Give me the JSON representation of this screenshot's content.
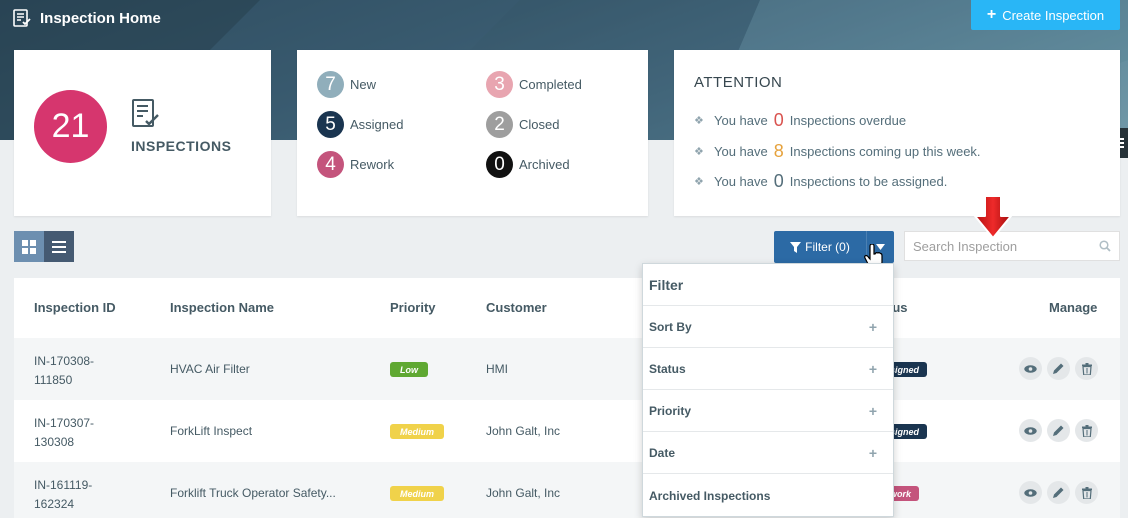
{
  "header": {
    "title": "Inspection Home",
    "create_button": "Create Inspection"
  },
  "summary": {
    "total": "21",
    "total_label": "INSPECTIONS"
  },
  "stats": [
    {
      "count": "7",
      "label": "New",
      "color": "#90aebb"
    },
    {
      "count": "5",
      "label": "Assigned",
      "color": "#1a3550"
    },
    {
      "count": "4",
      "label": "Rework",
      "color": "#c4547c"
    },
    {
      "count": "3",
      "label": "Completed",
      "color": "#e8a5b0"
    },
    {
      "count": "2",
      "label": "Closed",
      "color": "#9e9e9e"
    },
    {
      "count": "0",
      "label": "Archived",
      "color": "#111111"
    }
  ],
  "attention": {
    "title": "ATTENTION",
    "items": [
      {
        "prefix": "You have",
        "num": "0",
        "suffix": "Inspections overdue",
        "color": "#d9534f"
      },
      {
        "prefix": "You have",
        "num": "8",
        "suffix": "Inspections coming up this week.",
        "color": "#e6a23c"
      },
      {
        "prefix": "You have",
        "num": "0",
        "suffix": "Inspections to be assigned.",
        "color": "#546e7a"
      }
    ]
  },
  "toolbar": {
    "filter_label": "Filter (0)",
    "search_placeholder": "Search Inspection"
  },
  "table": {
    "headers": [
      "Inspection ID",
      "Inspection Name",
      "Priority",
      "Customer",
      "tus",
      "Manage"
    ],
    "rows": [
      {
        "id_line1": "IN-170308-",
        "id_line2": "111850",
        "name": "HVAC Air Filter",
        "priority": "Low",
        "priority_color": "#5fa832",
        "priority_text": "#ffffff",
        "customer": "HMI",
        "status": "signed",
        "status_color": "#1a3550"
      },
      {
        "id_line1": "IN-170307-",
        "id_line2": "130308",
        "name": "ForkLift Inspect",
        "priority": "Medium",
        "priority_color": "#f0d24a",
        "priority_text": "#ffffff",
        "customer": "John Galt, Inc",
        "status": "signed",
        "status_color": "#1a3550"
      },
      {
        "id_line1": "IN-161119-",
        "id_line2": "162324",
        "name": "Forklift Truck Operator Safety...",
        "priority": "Medium",
        "priority_color": "#f0d24a",
        "priority_text": "#ffffff",
        "customer": "John Galt, Inc",
        "status": "work",
        "status_color": "#c4547c"
      }
    ]
  },
  "filter_dropdown": {
    "title": "Filter",
    "items": [
      "Sort By",
      "Status",
      "Priority",
      "Date"
    ],
    "footer": "Archived Inspections",
    "plus": "+"
  },
  "colors": {
    "accent": "#29b6f6",
    "filter_button": "#2c6aa5",
    "annotation_arrow": "#e02020"
  }
}
